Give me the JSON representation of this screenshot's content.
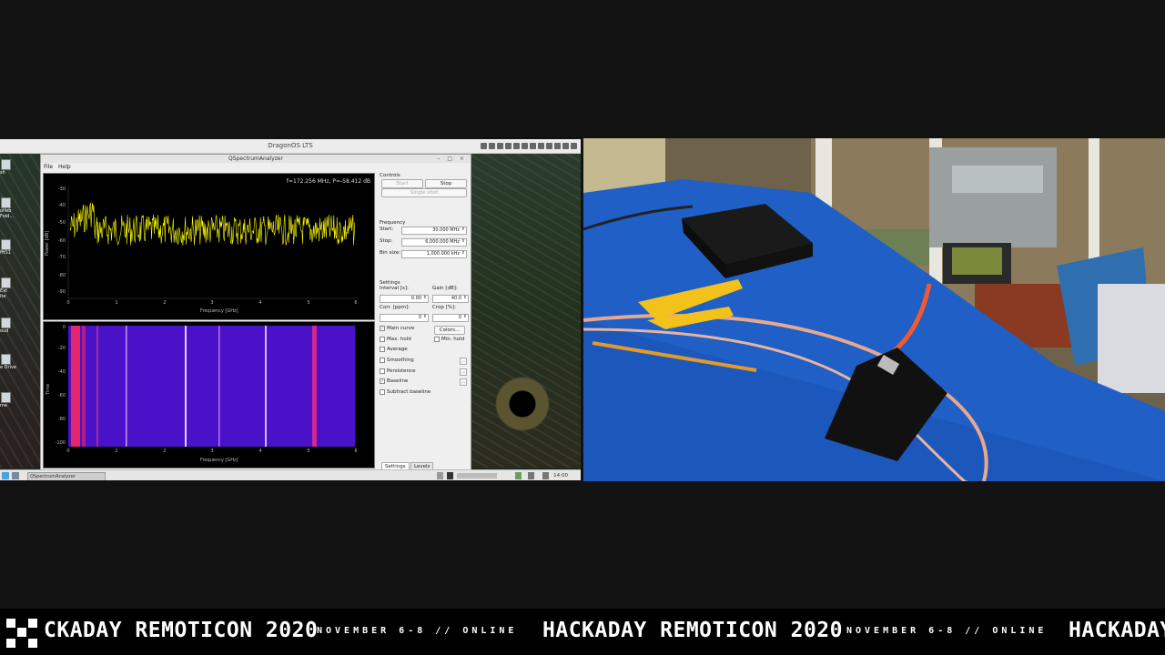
{
  "os": {
    "title": "DragonOS LTS",
    "desktop_icons": [
      "sh",
      "olfeb",
      "Fold...",
      "fHS1",
      "Ext",
      "ite",
      "oud",
      "e Drive",
      "me"
    ]
  },
  "app": {
    "title": "QSpectrumAnalyzer",
    "window_controls": "– □ ×",
    "menu": [
      "File",
      "Help"
    ],
    "readout": "f=172.256 MHz, P=-58.412 dB"
  },
  "spectrum": {
    "ylabel": "Power [dB]",
    "xlabel": "Frequency [GHz]",
    "yticks": [
      "-30",
      "-40",
      "-50",
      "-60",
      "-70",
      "-80",
      "-90"
    ],
    "xticks": [
      "0",
      "1",
      "2",
      "3",
      "4",
      "5",
      "6"
    ],
    "trace_color": "#ffff00"
  },
  "waterfall": {
    "ylabel": "Time",
    "xlabel": "Frequency [GHz]",
    "yticks": [
      "0",
      "-20",
      "-40",
      "-60",
      "-80",
      "-100"
    ],
    "xticks": [
      "0",
      "1",
      "2",
      "3",
      "4",
      "5",
      "6"
    ]
  },
  "controls": {
    "section": "Controls",
    "start": "Start",
    "stop": "Stop",
    "single_shot": "Single shot"
  },
  "frequency": {
    "section": "Frequency",
    "start_label": "Start:",
    "start_value": "30.000 MHz",
    "stop_label": "Stop:",
    "stop_value": "6,000.000 MHz",
    "bin_label": "Bin size:",
    "bin_value": "1,000.000 kHz"
  },
  "settings": {
    "section": "Settings",
    "interval_label": "Interval [s]:",
    "interval_value": "0.00",
    "gain_label": "Gain [dB]:",
    "gain_value": "40.0",
    "corr_label": "Corr. [ppm]:",
    "corr_value": "0",
    "crop_label": "Crop [%]:",
    "crop_value": "0",
    "colors_button": "Colors...",
    "checks": [
      {
        "label": "Main curve",
        "checked": true
      },
      {
        "label": "Max. hold",
        "checked": false
      },
      {
        "label": "Average",
        "checked": false
      },
      {
        "label": "Smoothing",
        "checked": false
      },
      {
        "label": "Persistence",
        "checked": false
      },
      {
        "label": "Baseline",
        "checked": true
      },
      {
        "label": "Subtract baseline",
        "checked": false
      }
    ],
    "min_hold": "Min. hold",
    "more": "..."
  },
  "tabs": [
    "Settings",
    "Levels"
  ],
  "taskbar": {
    "item": "QSpectrumAnalyzer",
    "clock": "14:00"
  },
  "banner": {
    "title_partial_start": "CKADAY REMOTICON 2020",
    "title": "HACKADAY REMOTICON 2020",
    "subtitle": "NOVEMBER 6-8 // ONLINE",
    "title_partial_end": "HACKADAY"
  }
}
